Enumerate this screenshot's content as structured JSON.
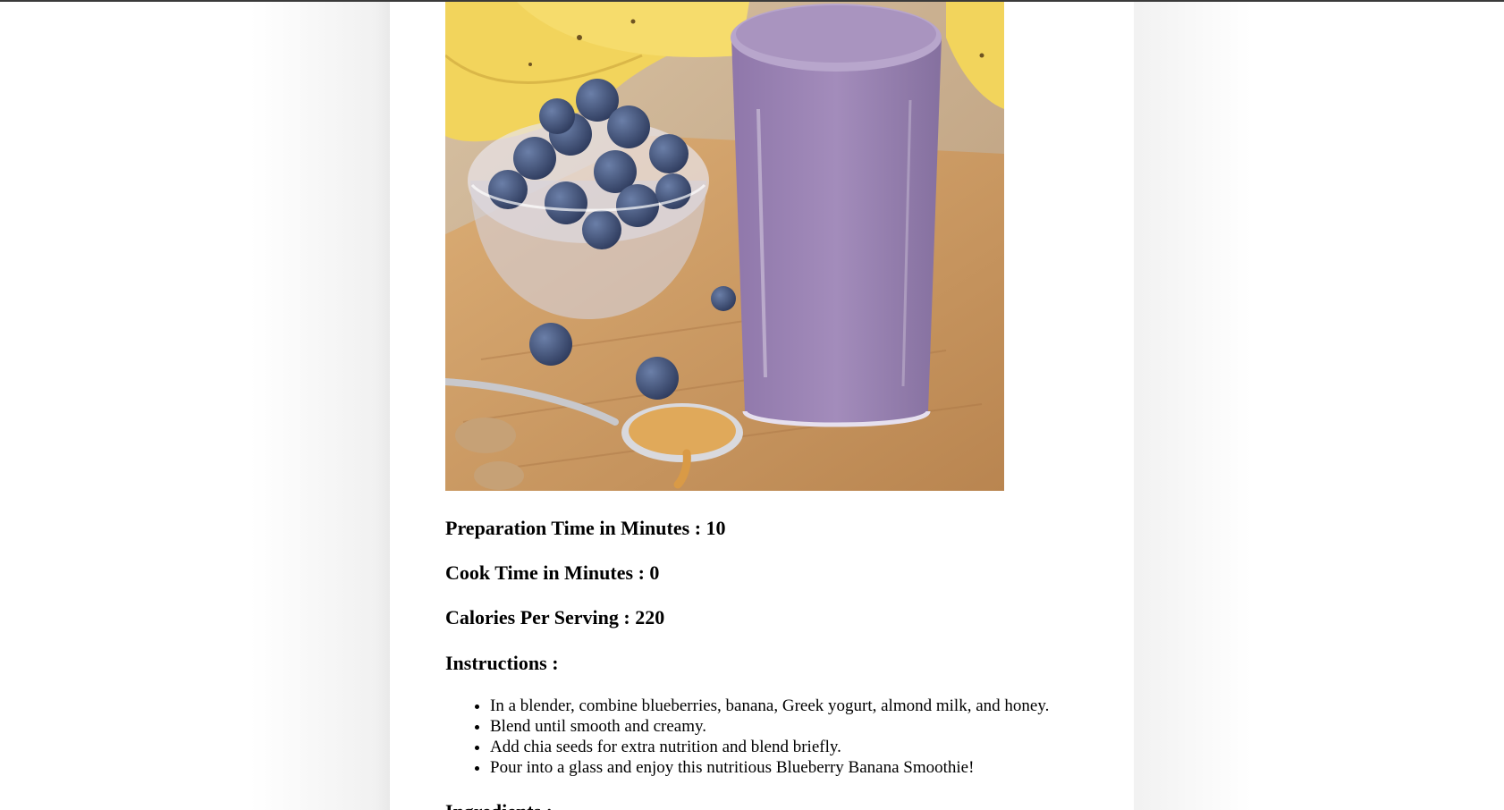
{
  "recipe": {
    "image_alt": "Blueberry Banana Smoothie",
    "prep_label": "Preparation Time in Minutes",
    "prep_value": "10",
    "cook_label": "Cook Time in Minutes",
    "cook_value": "0",
    "calories_label": "Calories Per Serving",
    "calories_value": "220",
    "instructions_label": "Instructions",
    "instructions": [
      "In a blender, combine blueberries, banana, Greek yogurt, almond milk, and honey.",
      "Blend until smooth and creamy.",
      "Add chia seeds for extra nutrition and blend briefly.",
      "Pour into a glass and enjoy this nutritious Blueberry Banana Smoothie!"
    ],
    "ingredients_label": "Ingredients",
    "separator": ":"
  },
  "colors": {
    "smoothie": "#9a82b0",
    "blueberry": "#3e4f7a",
    "banana": "#f2d45c",
    "board": "#c9975f",
    "peanut_butter": "#e0a95a"
  }
}
